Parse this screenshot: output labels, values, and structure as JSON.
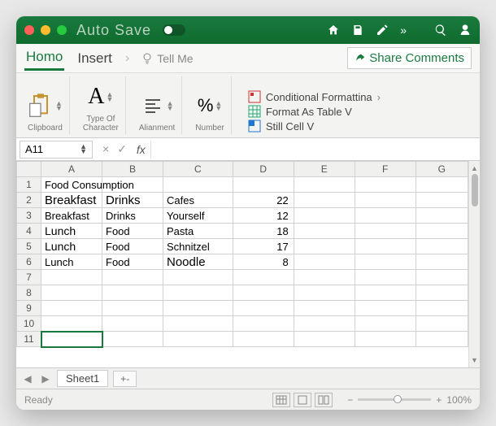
{
  "titlebar": {
    "autosave": "Auto Save",
    "icons": [
      "home-icon",
      "save-icon",
      "share-icon",
      "more-icon",
      "search-icon",
      "user-icon"
    ]
  },
  "menu": {
    "tabs": [
      "Homo",
      "Insert"
    ],
    "active": 0,
    "tellme": "Tell Me",
    "share": "Share Comments"
  },
  "ribbon": {
    "clipboard": "Clipboard",
    "font": "Type Of\nCharacter",
    "align": "Alianment",
    "number": "Number",
    "format": {
      "cond": "Conditional Formattina",
      "table": "Format As Table V",
      "cell": "Still Cell V"
    }
  },
  "namebox": "A11",
  "fx": "fx",
  "columns": [
    "",
    "A",
    "B",
    "C",
    "D",
    "E",
    "F",
    "G"
  ],
  "rows": [
    {
      "n": 1,
      "A": "Food Consumption"
    },
    {
      "n": 2,
      "A": "Breakfast",
      "B": "Drinks",
      "C": "Cafes",
      "D": "22"
    },
    {
      "n": 3,
      "A": "Breakfast",
      "B": "Drinks",
      "C": "Yourself",
      "D": "12"
    },
    {
      "n": 4,
      "A": "Lunch",
      "B": "Food",
      "C": "Pasta",
      "D": "18"
    },
    {
      "n": 5,
      "A": "Lunch",
      "B": "Food",
      "C": "Schnitzel",
      "D": "17"
    },
    {
      "n": 6,
      "A": "Lunch",
      "B": "Food",
      "C": "Noodle",
      "D": "8"
    },
    {
      "n": 7
    },
    {
      "n": 8
    },
    {
      "n": 9
    },
    {
      "n": 10
    },
    {
      "n": 11
    }
  ],
  "selected_cell": "A11",
  "sheet": {
    "nav_prev": "◀",
    "nav_next": "▶",
    "name": "Sheet1",
    "add": "+-"
  },
  "status": {
    "ready": "Ready",
    "zoom": "100%",
    "minus": "−",
    "plus": "+"
  }
}
